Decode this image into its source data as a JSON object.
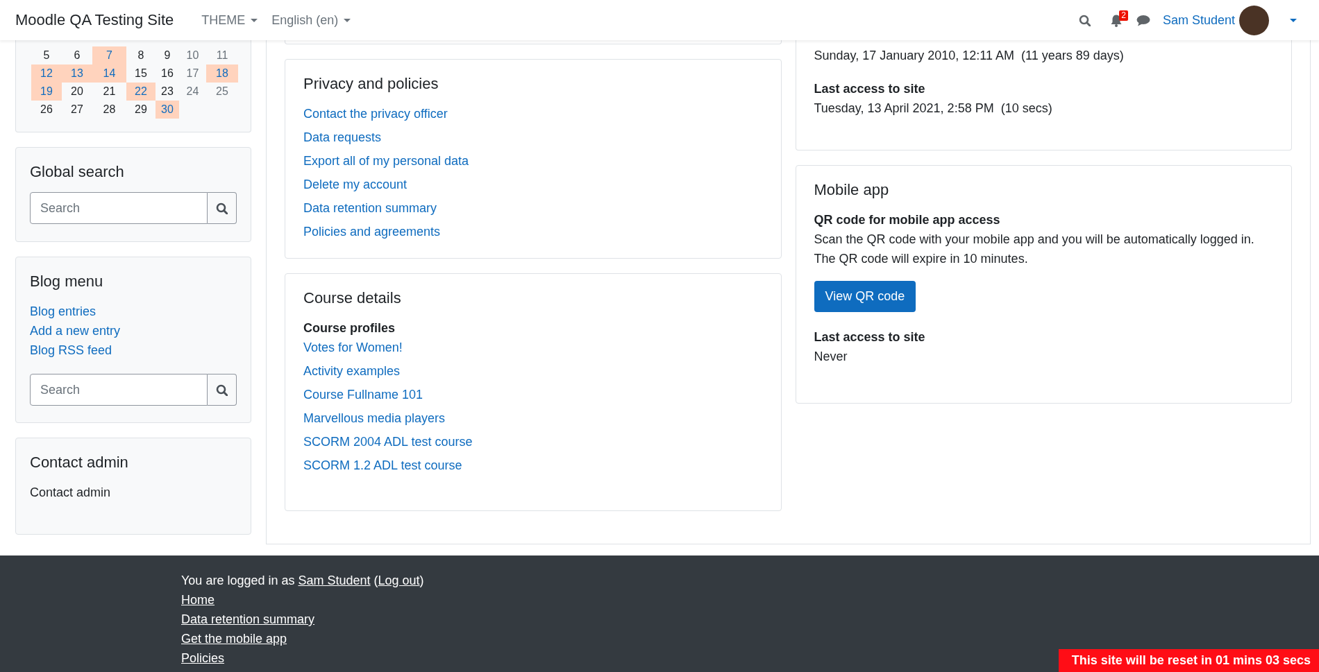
{
  "navbar": {
    "brand": "Moodle QA Testing Site",
    "menus": [
      {
        "label": "THEME"
      },
      {
        "label": "English (en)"
      }
    ],
    "notification_count": "2",
    "user_name": "Sam Student"
  },
  "calendar": {
    "weeks": [
      [
        {
          "day": "5",
          "event": false,
          "weekend": false
        },
        {
          "day": "6",
          "event": false,
          "weekend": false
        },
        {
          "day": "7",
          "event": true,
          "weekend": false
        },
        {
          "day": "8",
          "event": false,
          "weekend": false
        },
        {
          "day": "9",
          "event": false,
          "weekend": false
        },
        {
          "day": "10",
          "event": false,
          "weekend": true
        },
        {
          "day": "11",
          "event": false,
          "weekend": true
        }
      ],
      [
        {
          "day": "12",
          "event": true,
          "weekend": false
        },
        {
          "day": "13",
          "event": true,
          "weekend": false
        },
        {
          "day": "14",
          "event": true,
          "weekend": false
        },
        {
          "day": "15",
          "event": false,
          "weekend": false
        },
        {
          "day": "16",
          "event": false,
          "weekend": false
        },
        {
          "day": "17",
          "event": false,
          "weekend": true
        },
        {
          "day": "18",
          "event": true,
          "weekend": true
        }
      ],
      [
        {
          "day": "19",
          "event": true,
          "weekend": false
        },
        {
          "day": "20",
          "event": false,
          "weekend": false
        },
        {
          "day": "21",
          "event": false,
          "weekend": false
        },
        {
          "day": "22",
          "event": true,
          "weekend": false
        },
        {
          "day": "23",
          "event": false,
          "weekend": false
        },
        {
          "day": "24",
          "event": false,
          "weekend": true
        },
        {
          "day": "25",
          "event": false,
          "weekend": true
        }
      ],
      [
        {
          "day": "26",
          "event": false,
          "weekend": false
        },
        {
          "day": "27",
          "event": false,
          "weekend": false
        },
        {
          "day": "28",
          "event": false,
          "weekend": false
        },
        {
          "day": "29",
          "event": false,
          "weekend": false
        },
        {
          "day": "30",
          "event": true,
          "weekend": false
        }
      ]
    ]
  },
  "global_search": {
    "title": "Global search",
    "placeholder": "Search"
  },
  "blog_menu": {
    "title": "Blog menu",
    "links": [
      "Blog entries",
      "Add a new entry",
      "Blog RSS feed"
    ],
    "search_placeholder": "Search"
  },
  "contact_admin": {
    "title": "Contact admin",
    "link": "Contact admin"
  },
  "privacy": {
    "title": "Privacy and policies",
    "links": [
      "Contact the privacy officer",
      "Data requests",
      "Export all of my personal data",
      "Delete my account",
      "Data retention summary",
      "Policies and agreements"
    ]
  },
  "course_details": {
    "title": "Course details",
    "subtitle": "Course profiles",
    "links": [
      "Votes for Women!",
      "Activity examples",
      "Course Fullname 101",
      "Marvellous media players",
      "SCORM 2004 ADL test course",
      "SCORM 1.2 ADL test course"
    ]
  },
  "access": {
    "first_access_value": "Sunday, 17 January 2010, 12:11 AM  (11 years 89 days)",
    "last_access_label": "Last access to site",
    "last_access_value": "Tuesday, 13 April 2021, 2:58 PM  (10 secs)"
  },
  "mobile_app": {
    "title": "Mobile app",
    "qr_heading": "QR code for mobile app access",
    "description": "Scan the QR code with your mobile app and you will be automatically logged in. The QR code will expire in 10 minutes.",
    "button": "View QR code",
    "last_access_label": "Last access to site",
    "last_access_value": "Never"
  },
  "footer": {
    "prefix": "You are logged in as",
    "user": "Sam Student",
    "open_paren": "(",
    "logout": "Log out",
    "close_paren": ")",
    "links": [
      "Home",
      "Data retention summary",
      "Get the mobile app",
      "Policies"
    ]
  },
  "reset_banner": "This site will be reset in 01 mins 03 secs"
}
